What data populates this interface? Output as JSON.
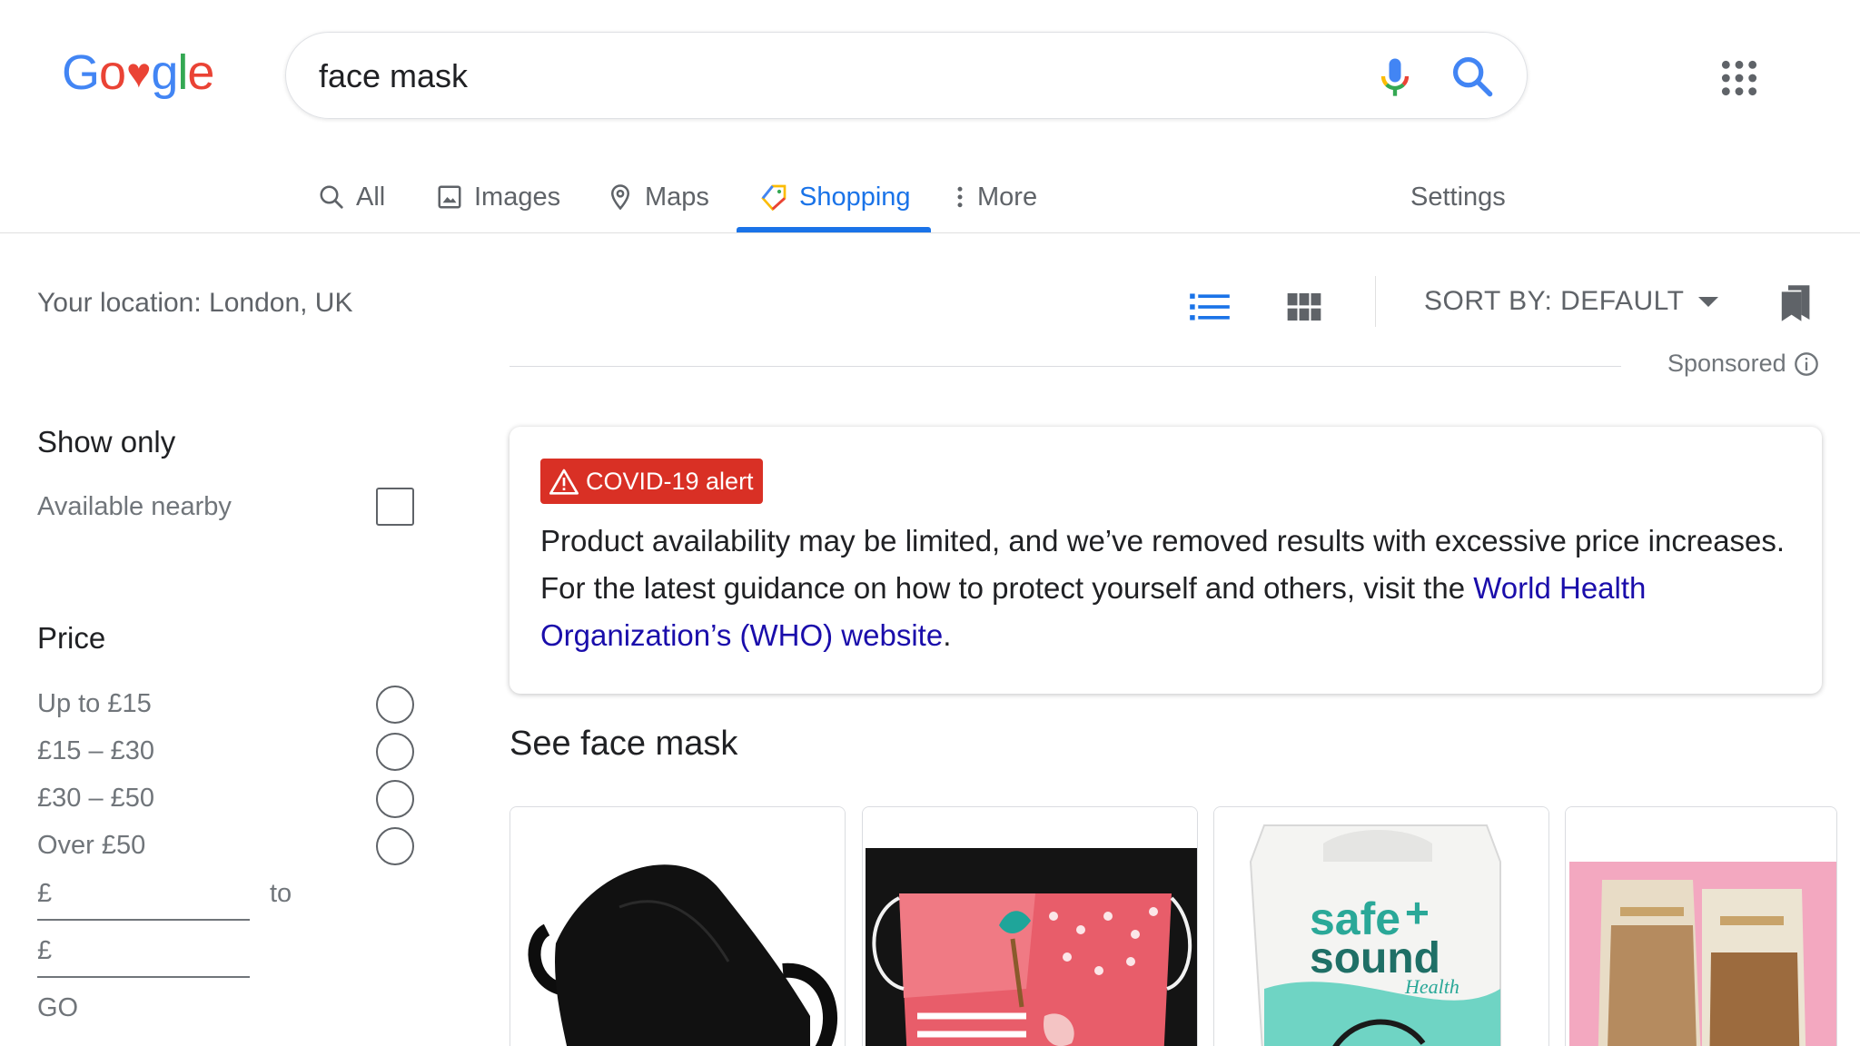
{
  "header": {
    "logo_letters": [
      {
        "char": "G",
        "color": "#4285f4"
      },
      {
        "char": "o",
        "color": "#ea4335"
      },
      {
        "char": "♥",
        "color": "#ea4335"
      },
      {
        "char": "g",
        "color": "#4285f4"
      },
      {
        "char": "l",
        "color": "#34a853"
      },
      {
        "char": "e",
        "color": "#ea4335"
      }
    ],
    "search_value": "face mask"
  },
  "tabs": [
    {
      "label": "All",
      "icon": "search-icon",
      "active": false
    },
    {
      "label": "Images",
      "icon": "image-icon",
      "active": false
    },
    {
      "label": "Maps",
      "icon": "map-pin-icon",
      "active": false
    },
    {
      "label": "Shopping",
      "icon": "tag-icon",
      "active": true
    },
    {
      "label": "More",
      "icon": "more-vert-icon",
      "active": false
    }
  ],
  "settings_label": "Settings",
  "toolbar": {
    "location": "Your location: London, UK",
    "sort_label": "SORT BY: DEFAULT",
    "sponsored": "Sponsored"
  },
  "filters": {
    "show_only_heading": "Show only",
    "available_nearby": "Available nearby",
    "price_heading": "Price",
    "price_options": [
      "Up to £15",
      "£15 – £30",
      "£30 – £50",
      "Over £50"
    ],
    "currency": "£",
    "to_label": "to",
    "go_label": "GO"
  },
  "alert": {
    "badge": "COVID-19 alert",
    "text": "Product availability may be limited, and we’ve removed results with excessive price increases. For the latest guidance on how to protect yourself and others, visit the ",
    "link": "World Health Organization’s (WHO) website",
    "end": "."
  },
  "results": {
    "heading": "See face mask",
    "products": [
      {
        "name": "black-face-mask"
      },
      {
        "name": "floral-pattern-face-mask"
      },
      {
        "name": "safe-sound-health-mask-box",
        "brand_text": "safe sound",
        "sub_text": "Health"
      },
      {
        "name": "herbal-powder-pouches"
      }
    ]
  },
  "colors": {
    "accent": "#1a73e8",
    "alert_red": "#d93025",
    "link": "#1a0dab"
  }
}
